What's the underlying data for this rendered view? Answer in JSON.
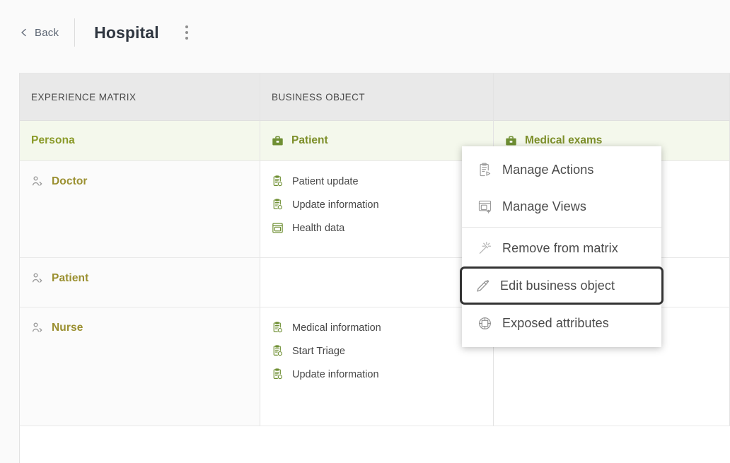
{
  "topbar": {
    "back_label": "Back",
    "back_icon": "chevron-left-icon",
    "title": "Hospital",
    "kebab_icon": "more-vertical-icon"
  },
  "matrix": {
    "headers": {
      "experience_matrix": "EXPERIENCE MATRIX",
      "business_object": "BUSINESS OBJECT"
    },
    "subheader": {
      "persona": "Persona",
      "objects": [
        {
          "label": "Patient",
          "icon": "briefcase-icon"
        },
        {
          "label": "Medical exams",
          "icon": "briefcase-icon"
        }
      ]
    },
    "rows": [
      {
        "persona": "Doctor",
        "persona_icon": "persona-icon",
        "patient_items": [
          {
            "label": "Patient update",
            "icon": "action-clipboard-icon"
          },
          {
            "label": "Update information",
            "icon": "action-clipboard-icon"
          },
          {
            "label": "Health data",
            "icon": "view-window-icon"
          }
        ],
        "exams_items": []
      },
      {
        "persona": "Patient",
        "persona_icon": "persona-icon",
        "patient_items": [],
        "exams_items": []
      },
      {
        "persona": "Nurse",
        "persona_icon": "persona-icon",
        "patient_items": [
          {
            "label": "Medical information",
            "icon": "action-clipboard-icon"
          },
          {
            "label": "Start Triage",
            "icon": "action-clipboard-icon"
          },
          {
            "label": "Update information",
            "icon": "action-clipboard-icon"
          }
        ],
        "exams_items": []
      }
    ]
  },
  "context_menu": {
    "items": [
      {
        "label": "Manage Actions",
        "icon": "manage-actions-icon",
        "highlighted": false
      },
      {
        "label": "Manage Views",
        "icon": "manage-views-icon",
        "highlighted": false
      },
      {
        "label": "Remove from matrix",
        "icon": "magic-wand-icon",
        "highlighted": false
      },
      {
        "label": "Edit business object",
        "icon": "pencil-icon",
        "highlighted": true
      },
      {
        "label": "Exposed attributes",
        "icon": "exposed-attributes-icon",
        "highlighted": false
      }
    ]
  },
  "colors": {
    "persona_green": "#9a8f2f",
    "object_green": "#7d8f2a",
    "icon_green": "#6f8f33",
    "header_band": "#e9e9e9",
    "subheader_band": "#f4f8ec",
    "highlight_border": "#333333"
  }
}
